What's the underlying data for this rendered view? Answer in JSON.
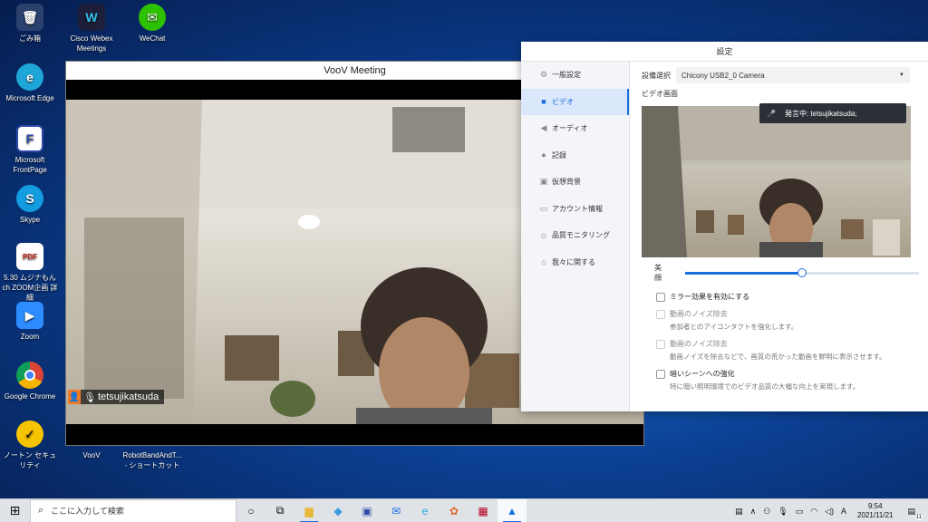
{
  "desktop": {
    "icons_col1": [
      {
        "label": "ごみ箱",
        "icon": "recycle-bin-icon"
      },
      {
        "label": "Microsoft Edge",
        "icon": "edge-icon"
      },
      {
        "label": "Microsoft FrontPage",
        "icon": "frontpage-icon"
      },
      {
        "label": "Skype",
        "icon": "skype-icon"
      },
      {
        "label": "5.30 ムジナもんch ZOOM企画 詳細",
        "icon": "pdf-icon"
      },
      {
        "label": "Zoom",
        "icon": "zoom-icon"
      },
      {
        "label": "Google Chrome",
        "icon": "chrome-icon"
      },
      {
        "label": "ノートン セキュリティ",
        "icon": "norton-icon"
      }
    ],
    "icons_top": [
      {
        "label": "Cisco Webex Meetings",
        "icon": "webex-icon"
      },
      {
        "label": "WeChat",
        "icon": "wechat-icon"
      }
    ],
    "icons_bottom": [
      {
        "label": "VooV",
        "icon": "voov-icon"
      },
      {
        "label": "RobotBandAndT... - ショートカット",
        "icon": "shortcut-icon"
      }
    ]
  },
  "voov_window": {
    "title": "VooV Meeting",
    "participant_name": "tetsujikatsuda"
  },
  "settings": {
    "title": "設定",
    "sidebar": [
      {
        "label": "一般設定",
        "icon": "gear-icon",
        "active": false
      },
      {
        "label": "ビデオ",
        "icon": "video-camera-icon",
        "active": true
      },
      {
        "label": "オーディオ",
        "icon": "speaker-icon",
        "active": false
      },
      {
        "label": "記録",
        "icon": "record-icon",
        "active": false
      },
      {
        "label": "仮想背景",
        "icon": "virtual-background-icon",
        "active": false
      },
      {
        "label": "アカウント情報",
        "icon": "account-card-icon",
        "active": false
      },
      {
        "label": "品質モニタリング",
        "icon": "quality-monitor-icon",
        "active": false
      },
      {
        "label": "我々に関する",
        "icon": "about-icon",
        "active": false
      }
    ],
    "device_label": "設備選択",
    "device_value": "Chicony USB2_0 Camera",
    "preview_label": "ビデオ画面",
    "speaking_text": "発言中: tetsujikatsuda;",
    "beauty_label": "美顔",
    "beauty_level_percent": 50,
    "options": [
      {
        "label": "ミラー効果を有効にする",
        "desc": "",
        "enabled": true
      },
      {
        "label": "動画のノイズ除去",
        "desc": "参加者とのアイコンタクトを強化します。",
        "enabled": false
      },
      {
        "label": "動画のノイズ除去",
        "desc": "動画ノイズを除去などで、画質の荒かった動画を鮮明に表示させます。",
        "enabled": false
      },
      {
        "label": "暗いシーンへの強化",
        "desc": "特に暗い照明環境でのビデオ品質の大幅な向上を実現します。",
        "enabled": true
      }
    ]
  },
  "taskbar": {
    "search_placeholder": "ここに入力して検索",
    "time": "9:54",
    "date": "2021/11/21",
    "ime": "A",
    "notification_count": "11"
  },
  "colors": {
    "accent": "#1a6fe0",
    "voov_orange": "#f07a28"
  }
}
